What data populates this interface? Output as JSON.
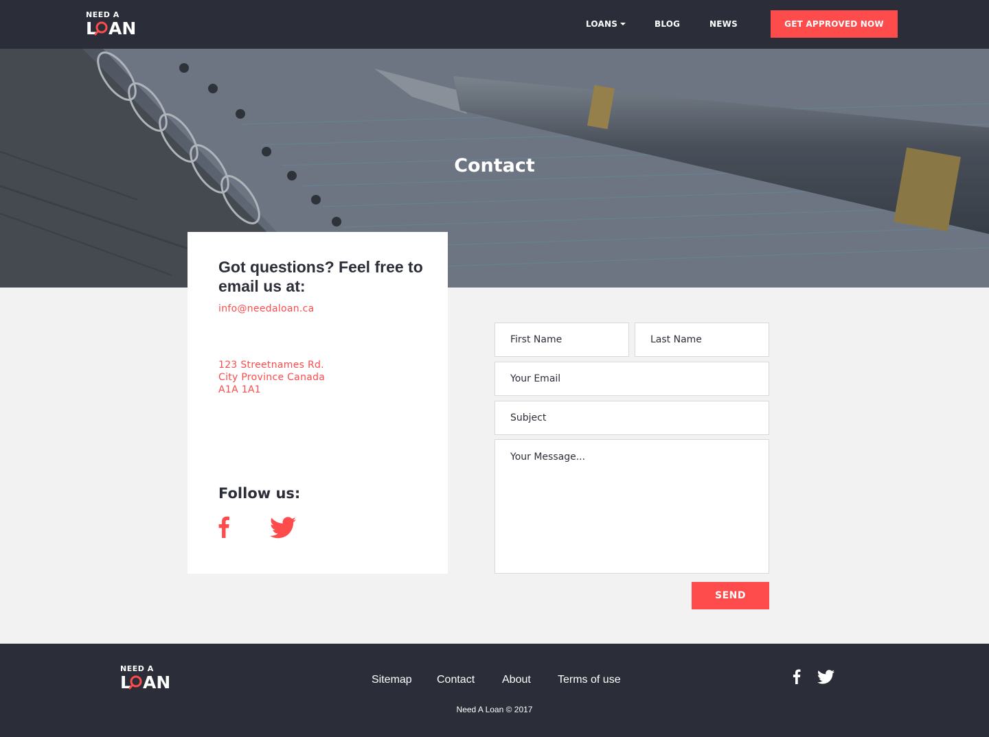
{
  "brand": {
    "logo_top": "NEED A",
    "logo_main": "LOAN",
    "accent_color": "#fe4b4b",
    "dark_color": "#2b2e38"
  },
  "nav": {
    "items": [
      "LOANS",
      "BLOG",
      "NEWS"
    ],
    "cta_label": "GET APPROVED NOW"
  },
  "hero": {
    "title": "Contact"
  },
  "info": {
    "heading": "Got questions? Feel free to email us at:",
    "email": "info@needaloan.ca",
    "address": [
      "123 Streetnames Rd.",
      "City Province Canada",
      "A1A 1A1"
    ],
    "follow_label": "Follow us:",
    "social_icons": [
      "facebook-icon",
      "twitter-icon"
    ]
  },
  "form": {
    "first_name_placeholder": "First Name",
    "last_name_placeholder": "Last Name",
    "email_placeholder": "Your Email",
    "subject_placeholder": "Subject",
    "message_placeholder": "Your Message...",
    "send_label": "SEND"
  },
  "footer": {
    "links": [
      "Sitemap",
      "Contact",
      "About",
      "Terms of use"
    ],
    "copyright": "Need A Loan © 2017",
    "social_icons": [
      "facebook-icon",
      "twitter-icon"
    ]
  }
}
